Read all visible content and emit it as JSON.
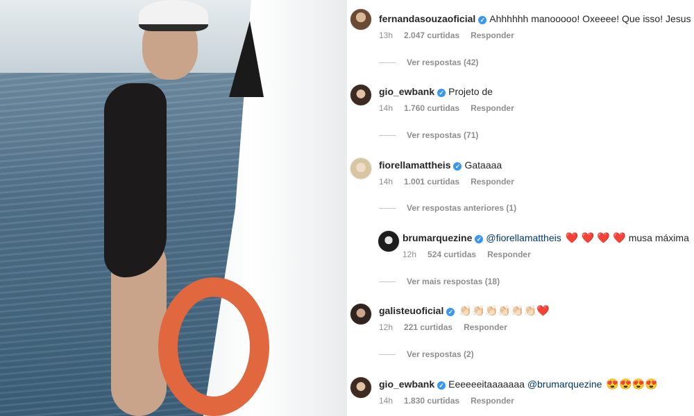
{
  "comments": [
    {
      "username": "fernandasouzaoficial",
      "text": "Ahhhhhh manooooo! Oxeeee! Que isso! Jesus",
      "time": "13h",
      "likes": "2.047 curtidas",
      "reply": "Responder",
      "view_replies": "Ver respostas (42)"
    },
    {
      "username": "gio_ewbank",
      "text": "Projeto de",
      "time": "14h",
      "likes": "1.760 curtidas",
      "reply": "Responder",
      "view_replies": "Ver respostas (71)"
    },
    {
      "username": "fiorellamattheis",
      "text": "Gataaaa",
      "time": "14h",
      "likes": "1.001 curtidas",
      "reply": "Responder",
      "view_replies": "Ver respostas anteriores (1)"
    },
    {
      "username": "brumarquezine",
      "mention": "@fiorellamattheis",
      "emoji": "❤️ ❤️ ❤️ ❤️",
      "text": "musa máxima",
      "time": "12h",
      "likes": "524 curtidas",
      "reply": "Responder",
      "view_replies": "Ver mais respostas (18)"
    },
    {
      "username": "galisteuoficial",
      "emoji": "👏🏻👏🏻👏🏻👏🏻👏🏻👏🏻❤️",
      "time": "12h",
      "likes": "221 curtidas",
      "reply": "Responder",
      "view_replies": "Ver respostas (2)"
    },
    {
      "username": "gio_ewbank",
      "text": "Eeeeeeitaaaaaaa",
      "mention": "@brumarquezine",
      "emoji": "😍😍😍😍",
      "time": "14h",
      "likes": "1.830 curtidas",
      "reply": "Responder"
    }
  ],
  "icons": {
    "verified": "verified-badge-icon"
  },
  "colors": {
    "verified": "#3897f0",
    "mention": "#00376b",
    "meta": "#8e8e8e"
  }
}
